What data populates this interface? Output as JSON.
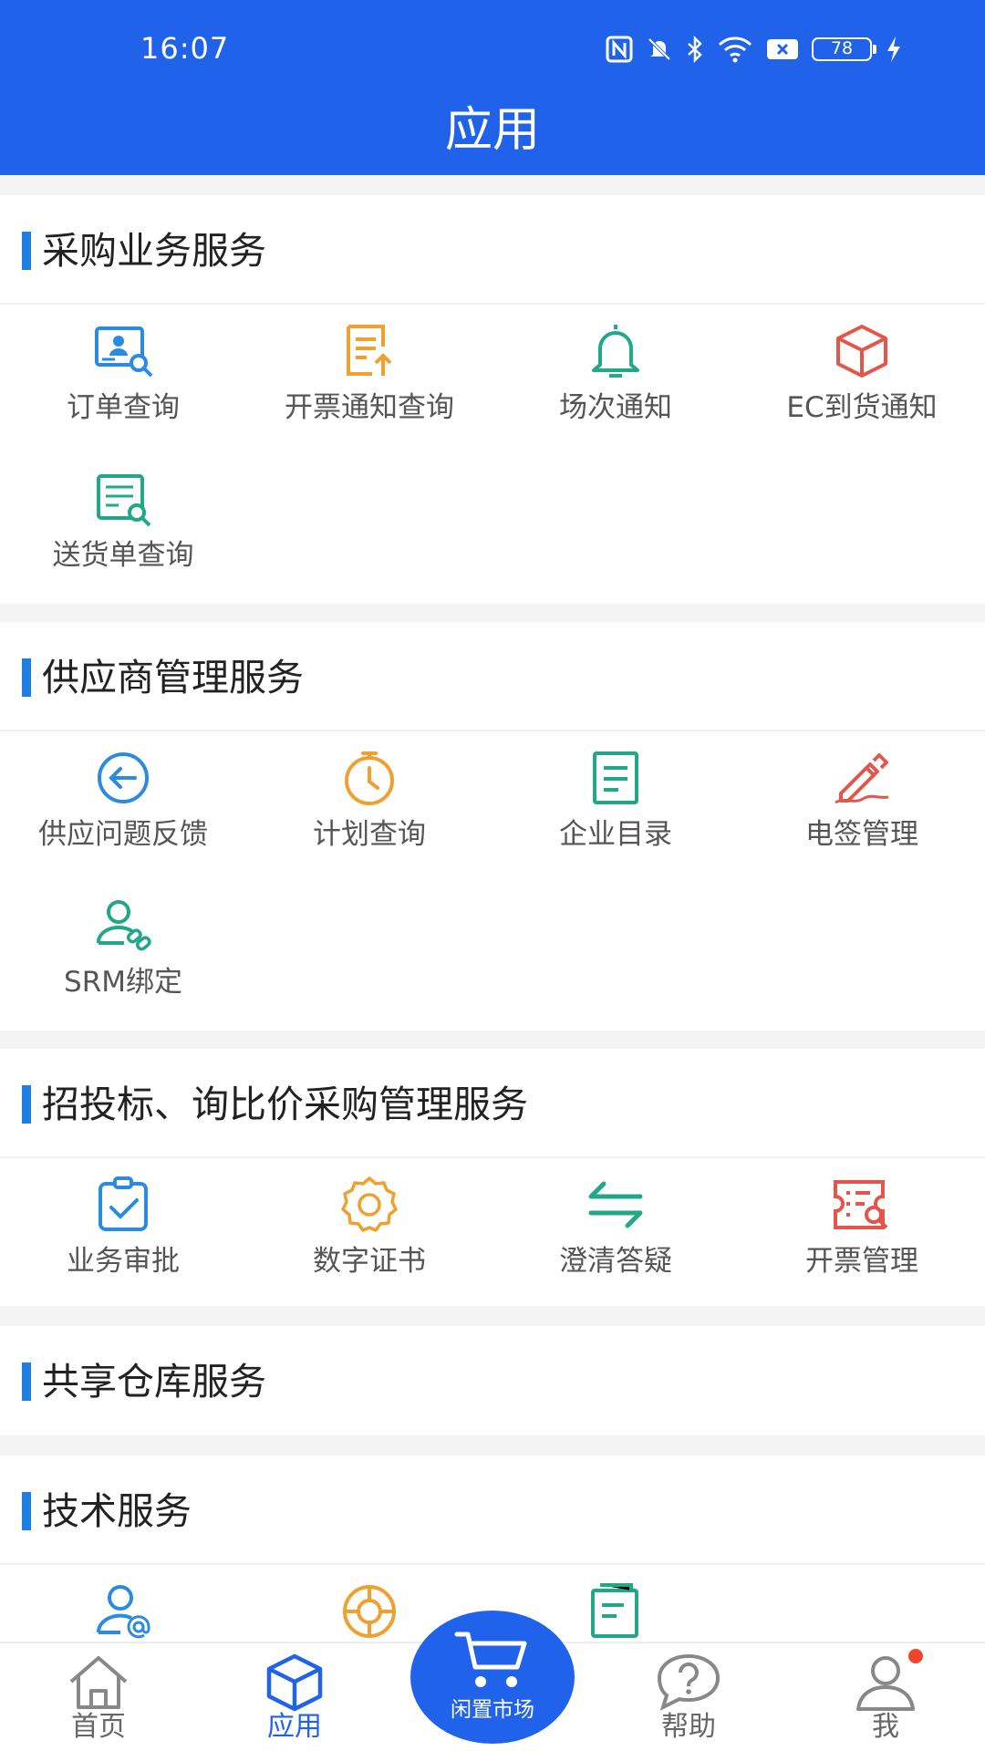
{
  "status_bar": {
    "time": "16:07",
    "battery": "78"
  },
  "header": {
    "title": "应用"
  },
  "colors": {
    "header_bg": "#2162ea",
    "section_bar": "#1f7fe0",
    "blue": "#2b8be0",
    "orange": "#f0a030",
    "green": "#20a889",
    "red": "#e3564d",
    "badge": "#f0462e"
  },
  "sections": [
    {
      "title": "采购业务服务",
      "items": [
        {
          "label": "订单查询",
          "icon": "order-search-icon"
        },
        {
          "label": "开票通知查询",
          "icon": "invoice-notice-icon"
        },
        {
          "label": "场次通知",
          "icon": "bell-icon"
        },
        {
          "label": "EC到货通知",
          "icon": "box-icon"
        },
        {
          "label": "送货单查询",
          "icon": "delivery-search-icon"
        }
      ]
    },
    {
      "title": "供应商管理服务",
      "items": [
        {
          "label": "供应问题反馈",
          "icon": "feedback-arrow-icon"
        },
        {
          "label": "计划查询",
          "icon": "timer-icon"
        },
        {
          "label": "企业目录",
          "icon": "document-list-icon"
        },
        {
          "label": "电签管理",
          "icon": "pen-signature-icon"
        },
        {
          "label": "SRM绑定",
          "icon": "user-link-icon"
        }
      ]
    },
    {
      "title": "招投标、询比价采购管理服务",
      "items": [
        {
          "label": "业务审批",
          "icon": "clipboard-check-icon"
        },
        {
          "label": "数字证书",
          "icon": "certificate-badge-icon"
        },
        {
          "label": "澄清答疑",
          "icon": "exchange-arrows-icon"
        },
        {
          "label": "开票管理",
          "icon": "invoice-manage-icon"
        }
      ]
    },
    {
      "title": "共享仓库服务",
      "items": []
    },
    {
      "title": "技术服务",
      "items": [
        {
          "label": "",
          "icon": "user-email-icon"
        },
        {
          "label": "",
          "icon": "lifebuoy-icon"
        },
        {
          "label": "",
          "icon": "notes-icon"
        }
      ]
    }
  ],
  "tabbar": {
    "home": "首页",
    "apps": "应用",
    "market": "闲置市场",
    "help": "帮助",
    "me": "我"
  }
}
